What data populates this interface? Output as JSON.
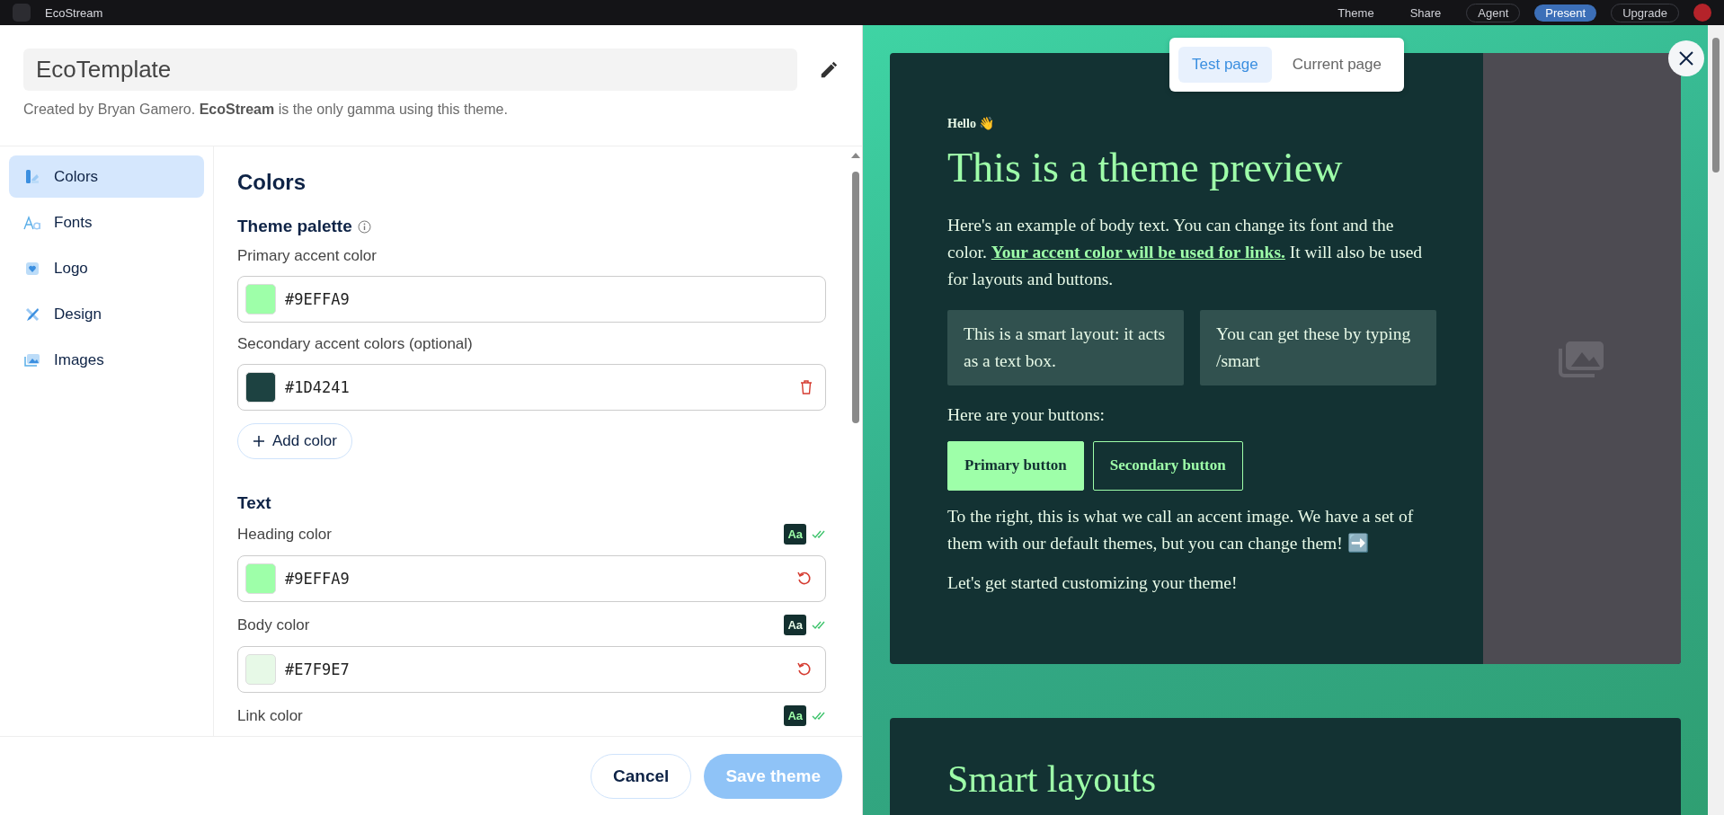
{
  "topbar": {
    "title": "EcoStream",
    "actions": [
      {
        "label": "Theme",
        "kind": "plain"
      },
      {
        "label": "Share",
        "kind": "plain"
      },
      {
        "label": "Agent",
        "kind": "outline"
      },
      {
        "label": "Present",
        "kind": "primary"
      },
      {
        "label": "Upgrade",
        "kind": "outline"
      }
    ]
  },
  "theme_name": {
    "value": "EcoTemplate"
  },
  "subtitle": "Created by Bryan Gamero. **EcoStream** is the only gamma using this theme.",
  "sidebar": {
    "items": [
      {
        "label": "Colors",
        "selected": true
      },
      {
        "label": "Fonts",
        "selected": false
      },
      {
        "label": "Logo",
        "selected": false
      },
      {
        "label": "Design",
        "selected": false
      },
      {
        "label": "Images",
        "selected": false
      }
    ]
  },
  "content": {
    "title": "Colors",
    "sections": [
      {
        "heading": "Theme palette",
        "info": true,
        "add_button": "Add color",
        "fields": [
          {
            "label": "Primary accent color",
            "value": "#9EFFA9",
            "color": "#9effa9",
            "kind": "plain"
          },
          {
            "label": "Secondary accent colors (optional)",
            "value": "#1D4241",
            "color": "#1d4241",
            "kind": "deletable"
          }
        ]
      },
      {
        "heading": "Text",
        "info": false,
        "fields": [
          {
            "label": "Heading color",
            "value": "#9EFFA9",
            "color": "#9effa9",
            "kind": "resettable",
            "badge": "Aa",
            "contrast_ok": true
          },
          {
            "label": "Body color",
            "value": "#E7F9E7",
            "color": "#e7f9e7",
            "kind": "resettable",
            "badge": "Aa",
            "contrast_ok": true
          },
          {
            "label": "Link color",
            "kind": "header",
            "badge": "Aa",
            "contrast_ok": true
          }
        ]
      }
    ]
  },
  "footer": {
    "buttons": [
      {
        "label": "Cancel",
        "kind": "secondary",
        "disabled": false
      },
      {
        "label": "Save theme",
        "kind": "primary",
        "disabled": true
      }
    ]
  },
  "preview": {
    "tabs": [
      {
        "label": "Test page",
        "selected": true
      },
      {
        "label": "Current page",
        "selected": false
      }
    ],
    "greeting": "Hello 👋",
    "heading": "This is a theme preview",
    "body_before": "Here's an example of body text. You can change its font and the color.",
    "link": "Your accent color will be used for links.",
    "body_after": "It will also be used for layouts and buttons.",
    "boxes": [
      "This is a smart layout: it acts as a text box.",
      "You can get these by typing /smart"
    ],
    "buttons_intro": "Here are your buttons:",
    "buttons": [
      {
        "label": "Primary button",
        "kind": "primary"
      },
      {
        "label": "Secondary button",
        "kind": "secondary"
      }
    ],
    "accent_text": "To the right, this is what we call an accent image. We have a set of them with our default themes, but you can change them! ➡️",
    "closing": "Let's get started customizing your theme!",
    "next_heading": "Smart layouts"
  }
}
